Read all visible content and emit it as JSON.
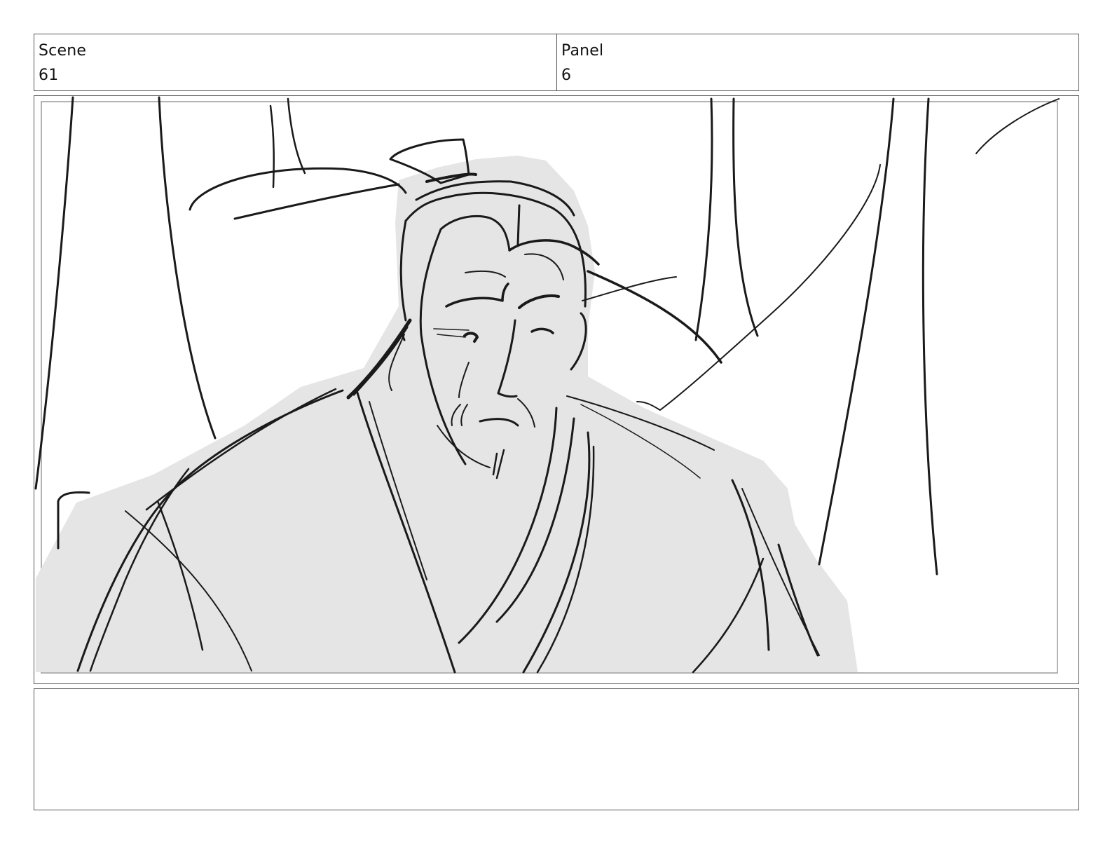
{
  "header": {
    "scene_label": "Scene",
    "scene_value": "61",
    "panel_label": "Panel",
    "panel_value": "6"
  },
  "notes": {
    "text": ""
  },
  "colors": {
    "line": "#1a1a1a",
    "figure_fill": "#e5e5e5",
    "border": "#555555"
  }
}
